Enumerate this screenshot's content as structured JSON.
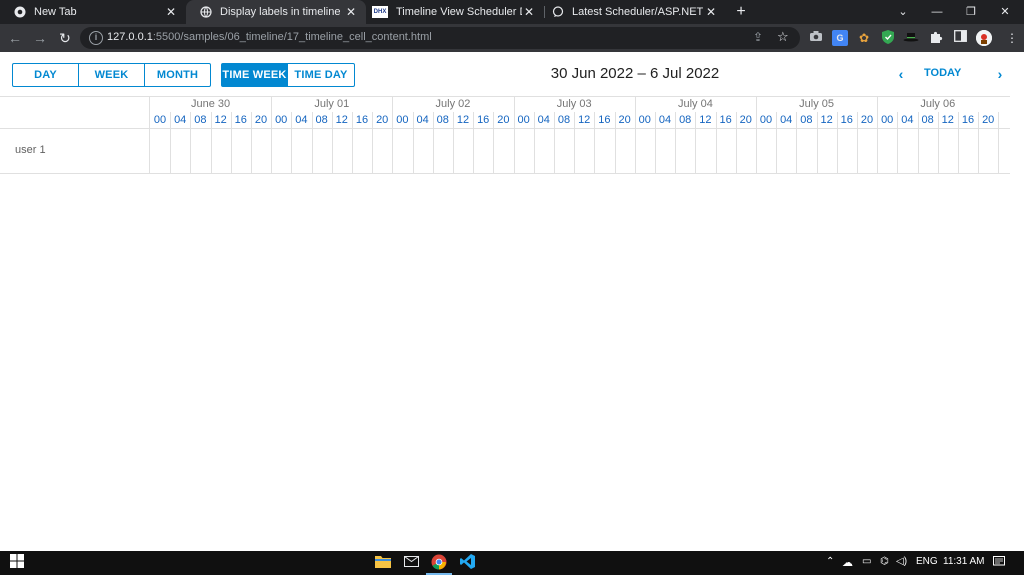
{
  "browser": {
    "tabs": [
      {
        "title": "New Tab",
        "favicon": "chrome-icon"
      },
      {
        "title": "Display labels in timeline cells",
        "favicon": "globe-icon"
      },
      {
        "title": "Timeline View Scheduler Docs",
        "favicon": "dhtmlx-icon"
      },
      {
        "title": "Latest Scheduler/ASP.NET MVC t",
        "favicon": "forum-icon"
      }
    ],
    "url_host": "127.0.0.1",
    "url_rest": ":5500/samples/06_timeline/17_timeline_cell_content.html"
  },
  "scheduler": {
    "view_tabs": [
      "DAY",
      "WEEK",
      "MONTH"
    ],
    "timeline_tabs": [
      "TIME WEEK",
      "TIME DAY"
    ],
    "active_tab": "TIME WEEK",
    "date_title": "30 Jun 2022 – 6 Jul 2022",
    "today_label": "TODAY",
    "days": [
      "June 30",
      "July 01",
      "July 02",
      "July 03",
      "July 04",
      "July 05",
      "July 06"
    ],
    "hours": [
      "00",
      "04",
      "08",
      "12",
      "16",
      "20"
    ],
    "rows": [
      {
        "label": "user 1"
      }
    ]
  },
  "taskbar": {
    "language": "ENG",
    "time": "11:31 AM"
  },
  "colors": {
    "accent": "#0288d1",
    "hour_text": "#1565c0"
  }
}
